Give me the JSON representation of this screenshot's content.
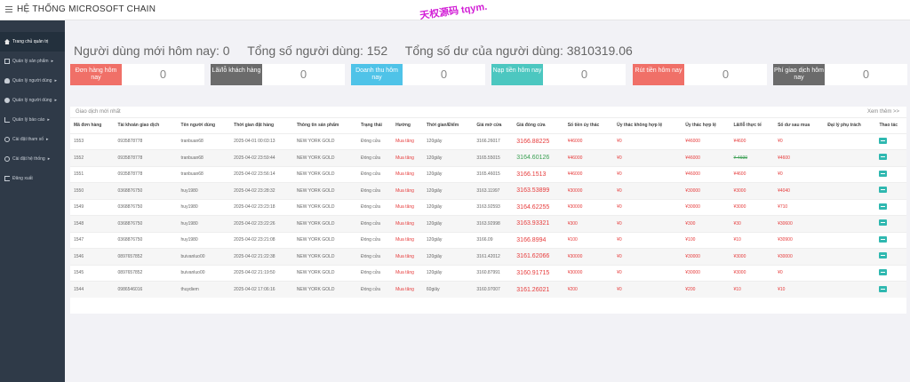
{
  "app_title": "HỆ THỐNG MICROSOFT CHAIN",
  "watermark": "天权源码 tqym.",
  "sidebar": {
    "items": [
      {
        "label": "Trang chủ quản trị",
        "icon": "home-icon",
        "caret": ""
      },
      {
        "label": "Quản lý sản phẩm",
        "icon": "box-icon",
        "caret": "▸"
      },
      {
        "label": "Quản lý người dùng",
        "icon": "users-icon",
        "caret": "▸"
      },
      {
        "label": "Quản lý người dùng",
        "icon": "user-icon",
        "caret": "▸"
      },
      {
        "label": "Quản lý báo cáo",
        "icon": "chart-icon",
        "caret": "▸"
      },
      {
        "label": "Cài đặt tham số",
        "icon": "gear-icon",
        "caret": "▸"
      },
      {
        "label": "Cài đặt hệ thống",
        "icon": "gear-icon",
        "caret": "▸"
      },
      {
        "label": "Đăng xuất",
        "icon": "logout-icon",
        "caret": ""
      }
    ]
  },
  "stats": {
    "new_users": "Người dùng mới hôm nay: 0",
    "total_users": "Tổng số người dùng: 152",
    "total_balance": "Tổng số dư của người dùng: 3810319.06"
  },
  "cards": [
    {
      "label": "Đơn hàng hôm nay",
      "value": "0",
      "color": "#f07068"
    },
    {
      "label": "Lãi/lỗ khách hàng",
      "value": "0",
      "color": "#6b6b6b"
    },
    {
      "label": "Doanh thu hôm nay",
      "value": "0",
      "color": "#4fc3e8"
    },
    {
      "label": "Nạp tiền hôm nay",
      "value": "0",
      "color": "#4cc7c0"
    },
    {
      "label": "Rút tiền hôm nay",
      "value": "0",
      "color": "#f07068"
    },
    {
      "label": "Phí giao dịch hôm nay",
      "value": "0",
      "color": "#6b6b6b"
    }
  ],
  "panel": {
    "title": "Giao dịch mới nhất",
    "more": "Xem thêm >>"
  },
  "table": {
    "headers": [
      "Mã đơn hàng",
      "Tài khoản giao dịch",
      "Tên người dùng",
      "Thời gian đặt hàng",
      "Thông tin sản phẩm",
      "Trạng thái",
      "Hướng",
      "Thời gian/Điểm",
      "Giá mở cửa",
      "Giá đóng cửa",
      "Số tiền ủy thác",
      "Ủy thác không hợp lệ",
      "Ủy thác hợp lệ",
      "Lãi/lỗ thực tế",
      "Số dư sau mua",
      "Đại lý phụ trách",
      "Thao tác"
    ],
    "rows": [
      {
        "id": "1553",
        "account": "0935878778",
        "user": "tranbuan68",
        "time": "2025-04-01 00:03:13",
        "product": "NEW YORK GOLD",
        "status": "Đóng cửa",
        "direction": "Mua tăng",
        "period": "120giây",
        "open": "3166.26017",
        "close": "3166.88225",
        "close_color": "red",
        "amount": "¥46000",
        "invalid": "¥0",
        "valid": "¥46000",
        "pnl": "¥4600",
        "pnl_strike": false,
        "balance": "¥0",
        "agent": ""
      },
      {
        "id": "1552",
        "account": "0935878778",
        "user": "tranbuan68",
        "time": "2025-04-02 23:59:44",
        "product": "NEW YORK GOLD",
        "status": "Đóng cửa",
        "direction": "Mua tăng",
        "period": "120giây",
        "open": "3165.55015",
        "close": "3164.60126",
        "close_color": "green",
        "amount": "¥46000",
        "invalid": "¥0",
        "valid": "¥46000",
        "pnl": "¥-4600",
        "pnl_strike": true,
        "balance": "¥4600",
        "agent": ""
      },
      {
        "id": "1551",
        "account": "0935878778",
        "user": "tranbuan68",
        "time": "2025-04-02 23:56:14",
        "product": "NEW YORK GOLD",
        "status": "Đóng cửa",
        "direction": "Mua tăng",
        "period": "120giây",
        "open": "3165.46015",
        "close": "3166.1513",
        "close_color": "red",
        "amount": "¥46000",
        "invalid": "¥0",
        "valid": "¥46000",
        "pnl": "¥4600",
        "pnl_strike": false,
        "balance": "¥0",
        "agent": ""
      },
      {
        "id": "1550",
        "account": "0368876750",
        "user": "huy1980",
        "time": "2025-04-02 23:28:32",
        "product": "NEW YORK GOLD",
        "status": "Đóng cửa",
        "direction": "Mua tăng",
        "period": "120giây",
        "open": "3163.11997",
        "close": "3163.53899",
        "close_color": "red",
        "amount": "¥30000",
        "invalid": "¥0",
        "valid": "¥30000",
        "pnl": "¥3000",
        "pnl_strike": false,
        "balance": "¥4040",
        "agent": ""
      },
      {
        "id": "1549",
        "account": "0368876750",
        "user": "huy1980",
        "time": "2025-04-02 23:23:18",
        "product": "NEW YORK GOLD",
        "status": "Đóng cửa",
        "direction": "Mua tăng",
        "period": "120giây",
        "open": "3163.92593",
        "close": "3164.62255",
        "close_color": "red",
        "amount": "¥30000",
        "invalid": "¥0",
        "valid": "¥30000",
        "pnl": "¥3000",
        "pnl_strike": false,
        "balance": "¥710",
        "agent": ""
      },
      {
        "id": "1548",
        "account": "0368876750",
        "user": "huy1980",
        "time": "2025-04-02 23:22:26",
        "product": "NEW YORK GOLD",
        "status": "Đóng cửa",
        "direction": "Mua tăng",
        "period": "120giây",
        "open": "3163.92998",
        "close": "3163.93321",
        "close_color": "red",
        "amount": "¥300",
        "invalid": "¥0",
        "valid": "¥300",
        "pnl": "¥30",
        "pnl_strike": false,
        "balance": "¥30600",
        "agent": ""
      },
      {
        "id": "1547",
        "account": "0368876750",
        "user": "huy1980",
        "time": "2025-04-02 23:21:08",
        "product": "NEW YORK GOLD",
        "status": "Đóng cửa",
        "direction": "Mua tăng",
        "period": "120giây",
        "open": "3166.09",
        "close": "3166.8994",
        "close_color": "red",
        "amount": "¥100",
        "invalid": "¥0",
        "valid": "¥100",
        "pnl": "¥10",
        "pnl_strike": false,
        "balance": "¥30900",
        "agent": ""
      },
      {
        "id": "1546",
        "account": "0897657852",
        "user": "buivanluo00",
        "time": "2025-04-02 21:22:38",
        "product": "NEW YORK GOLD",
        "status": "Đóng cửa",
        "direction": "Mua tăng",
        "period": "120giây",
        "open": "3161.42012",
        "close": "3161.62066",
        "close_color": "red",
        "amount": "¥30000",
        "invalid": "¥0",
        "valid": "¥30000",
        "pnl": "¥3000",
        "pnl_strike": false,
        "balance": "¥30000",
        "agent": ""
      },
      {
        "id": "1545",
        "account": "0897657852",
        "user": "buivanluo00",
        "time": "2025-04-02 21:19:50",
        "product": "NEW YORK GOLD",
        "status": "Đóng cửa",
        "direction": "Mua tăng",
        "period": "120giây",
        "open": "3160.87991",
        "close": "3160.91715",
        "close_color": "red",
        "amount": "¥30000",
        "invalid": "¥0",
        "valid": "¥30000",
        "pnl": "¥3000",
        "pnl_strike": false,
        "balance": "¥0",
        "agent": ""
      },
      {
        "id": "1544",
        "account": "0986546016",
        "user": "thuydiem",
        "time": "2025-04-02 17:06:16",
        "product": "NEW YORK GOLD",
        "status": "Đóng cửa",
        "direction": "Mua tăng",
        "period": "60giây",
        "open": "3160.97007",
        "close": "3161.26021",
        "close_color": "red",
        "amount": "¥200",
        "invalid": "¥0",
        "valid": "¥200",
        "pnl": "¥10",
        "pnl_strike": false,
        "balance": "¥10",
        "agent": ""
      }
    ]
  }
}
